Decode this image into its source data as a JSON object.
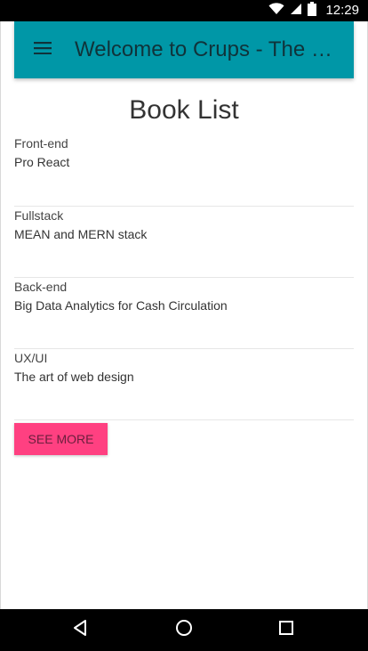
{
  "status_bar": {
    "time": "12:29",
    "icons": [
      "wifi-icon",
      "signal-icon",
      "battery-icon"
    ]
  },
  "app_bar": {
    "menu_icon": "menu-icon",
    "title": "Welcome to Crups - The Cash Circulation",
    "background_color": "#0097a7"
  },
  "main": {
    "title": "Book List",
    "books": [
      {
        "category": "Front-end",
        "title": "Pro React"
      },
      {
        "category": "Fullstack",
        "title": "MEAN and MERN stack"
      },
      {
        "category": "Back-end",
        "title": "Big Data Analytics for Cash Circulation"
      },
      {
        "category": "UX/UI",
        "title": "The art of web design"
      }
    ],
    "see_more_label": "SEE MORE",
    "see_more_color": "#ff4081"
  },
  "nav_bar": {
    "buttons": [
      "back-icon",
      "home-icon",
      "recents-icon"
    ]
  }
}
